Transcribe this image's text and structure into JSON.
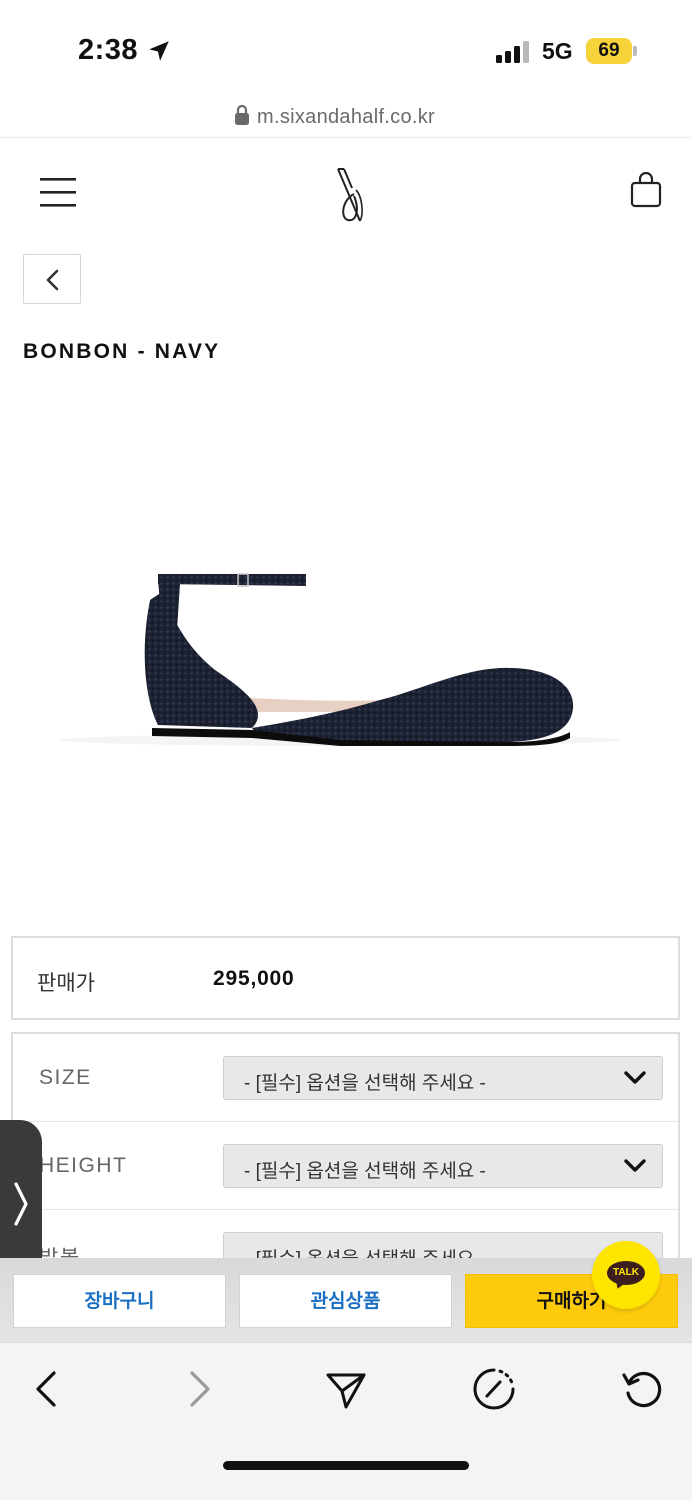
{
  "status_bar": {
    "time": "2:38",
    "network": "5G",
    "battery": "69",
    "icons": [
      "location-arrow-icon",
      "signal-icon"
    ]
  },
  "browser": {
    "url": "m.sixandahalf.co.kr"
  },
  "header": {
    "icons": [
      "menu-icon",
      "logo-icon",
      "shopping-bag-icon",
      "back-arrow-icon"
    ]
  },
  "product": {
    "title": "BONBON - NAVY",
    "price_label": "판매가",
    "price": "295,000"
  },
  "options": [
    {
      "label": "SIZE",
      "placeholder": "- [필수] 옵션을 선택해 주세요 -"
    },
    {
      "label": "HEIGHT",
      "placeholder": "- [필수] 옵션을 선택해 주세요 -"
    },
    {
      "label": "발볼",
      "placeholder": "- [필수] 옵션을 선택해 주세요 -"
    }
  ],
  "actions": {
    "cart": "장바구니",
    "wishlist": "관심상품",
    "buy": "구매하기",
    "talk": "TALK"
  },
  "colors": {
    "buy_button": "#fecb0a",
    "action_text": "#1a6fc2",
    "talk_button": "#fee500",
    "battery": "#f6d33b"
  }
}
